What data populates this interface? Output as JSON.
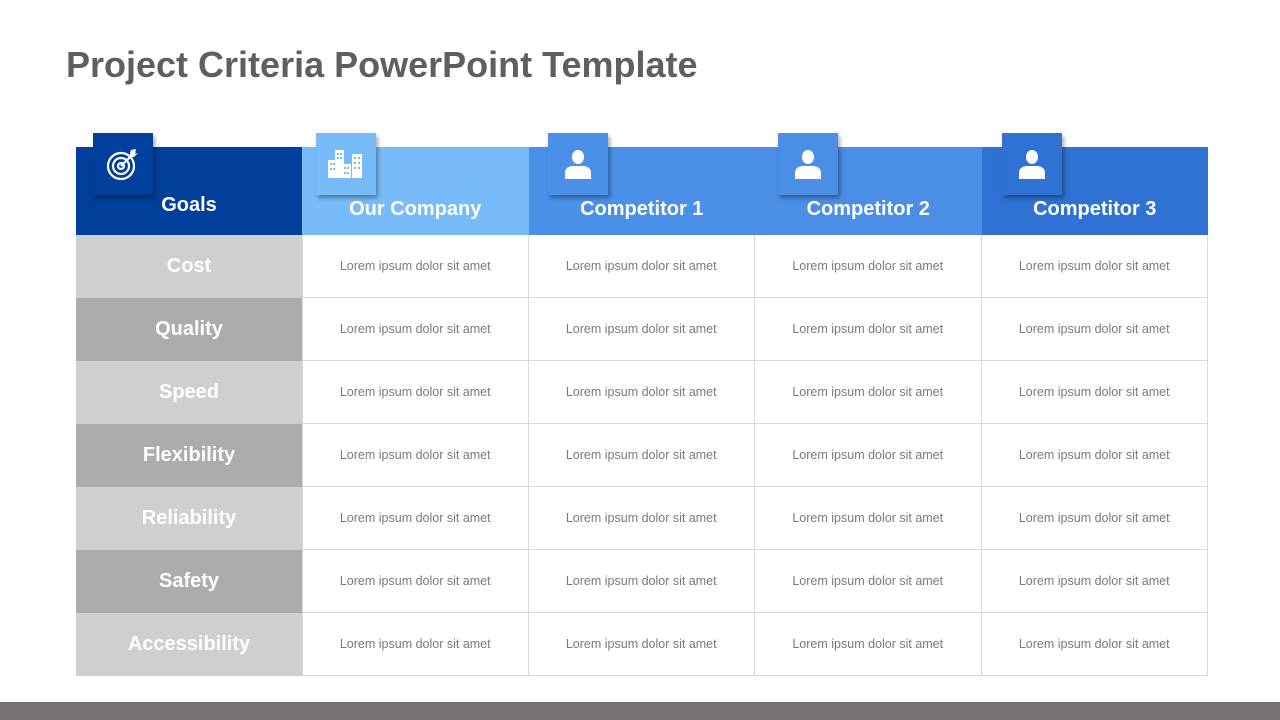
{
  "title": "Project Criteria PowerPoint Template",
  "colors": {
    "goals_header": "#003f9b",
    "our_company_header": "#78bbf9",
    "competitor1_header": "#4a90e8",
    "competitor2_header": "#4a8fe5",
    "competitor3_header": "#2f72d3",
    "goal_row_light": "#d0cfcf",
    "goal_row_dark": "#adacab",
    "footer_bar": "#787372"
  },
  "header": {
    "columns": [
      {
        "label": "Goals",
        "icon": "target-icon"
      },
      {
        "label": "Our Company",
        "icon": "buildings-icon"
      },
      {
        "label": "Competitor 1",
        "icon": "person-icon"
      },
      {
        "label": "Competitor 2",
        "icon": "person-icon"
      },
      {
        "label": "Competitor 3",
        "icon": "person-icon"
      }
    ]
  },
  "rows": [
    {
      "goal": "Cost",
      "cells": [
        "Lorem ipsum dolor sit amet",
        "Lorem ipsum dolor sit amet",
        "Lorem ipsum dolor sit amet",
        "Lorem ipsum dolor sit amet"
      ]
    },
    {
      "goal": "Quality",
      "cells": [
        "Lorem ipsum dolor sit amet",
        "Lorem ipsum dolor sit amet",
        "Lorem ipsum dolor sit amet",
        "Lorem ipsum dolor sit amet"
      ]
    },
    {
      "goal": "Speed",
      "cells": [
        "Lorem ipsum dolor sit amet",
        "Lorem ipsum dolor sit amet",
        "Lorem ipsum dolor sit amet",
        "Lorem ipsum dolor sit amet"
      ]
    },
    {
      "goal": "Flexibility",
      "cells": [
        "Lorem ipsum dolor sit amet",
        "Lorem ipsum dolor sit amet",
        "Lorem ipsum dolor sit amet",
        "Lorem ipsum dolor sit amet"
      ]
    },
    {
      "goal": "Reliability",
      "cells": [
        "Lorem ipsum dolor sit amet",
        "Lorem ipsum dolor sit amet",
        "Lorem ipsum dolor sit amet",
        "Lorem ipsum dolor sit amet"
      ]
    },
    {
      "goal": "Safety",
      "cells": [
        "Lorem ipsum dolor sit amet",
        "Lorem ipsum dolor sit amet",
        "Lorem ipsum dolor sit amet",
        "Lorem ipsum dolor sit amet"
      ]
    },
    {
      "goal": "Accessibility",
      "cells": [
        "Lorem ipsum dolor sit amet",
        "Lorem ipsum dolor sit amet",
        "Lorem ipsum dolor sit amet",
        "Lorem ipsum dolor sit amet"
      ]
    }
  ]
}
